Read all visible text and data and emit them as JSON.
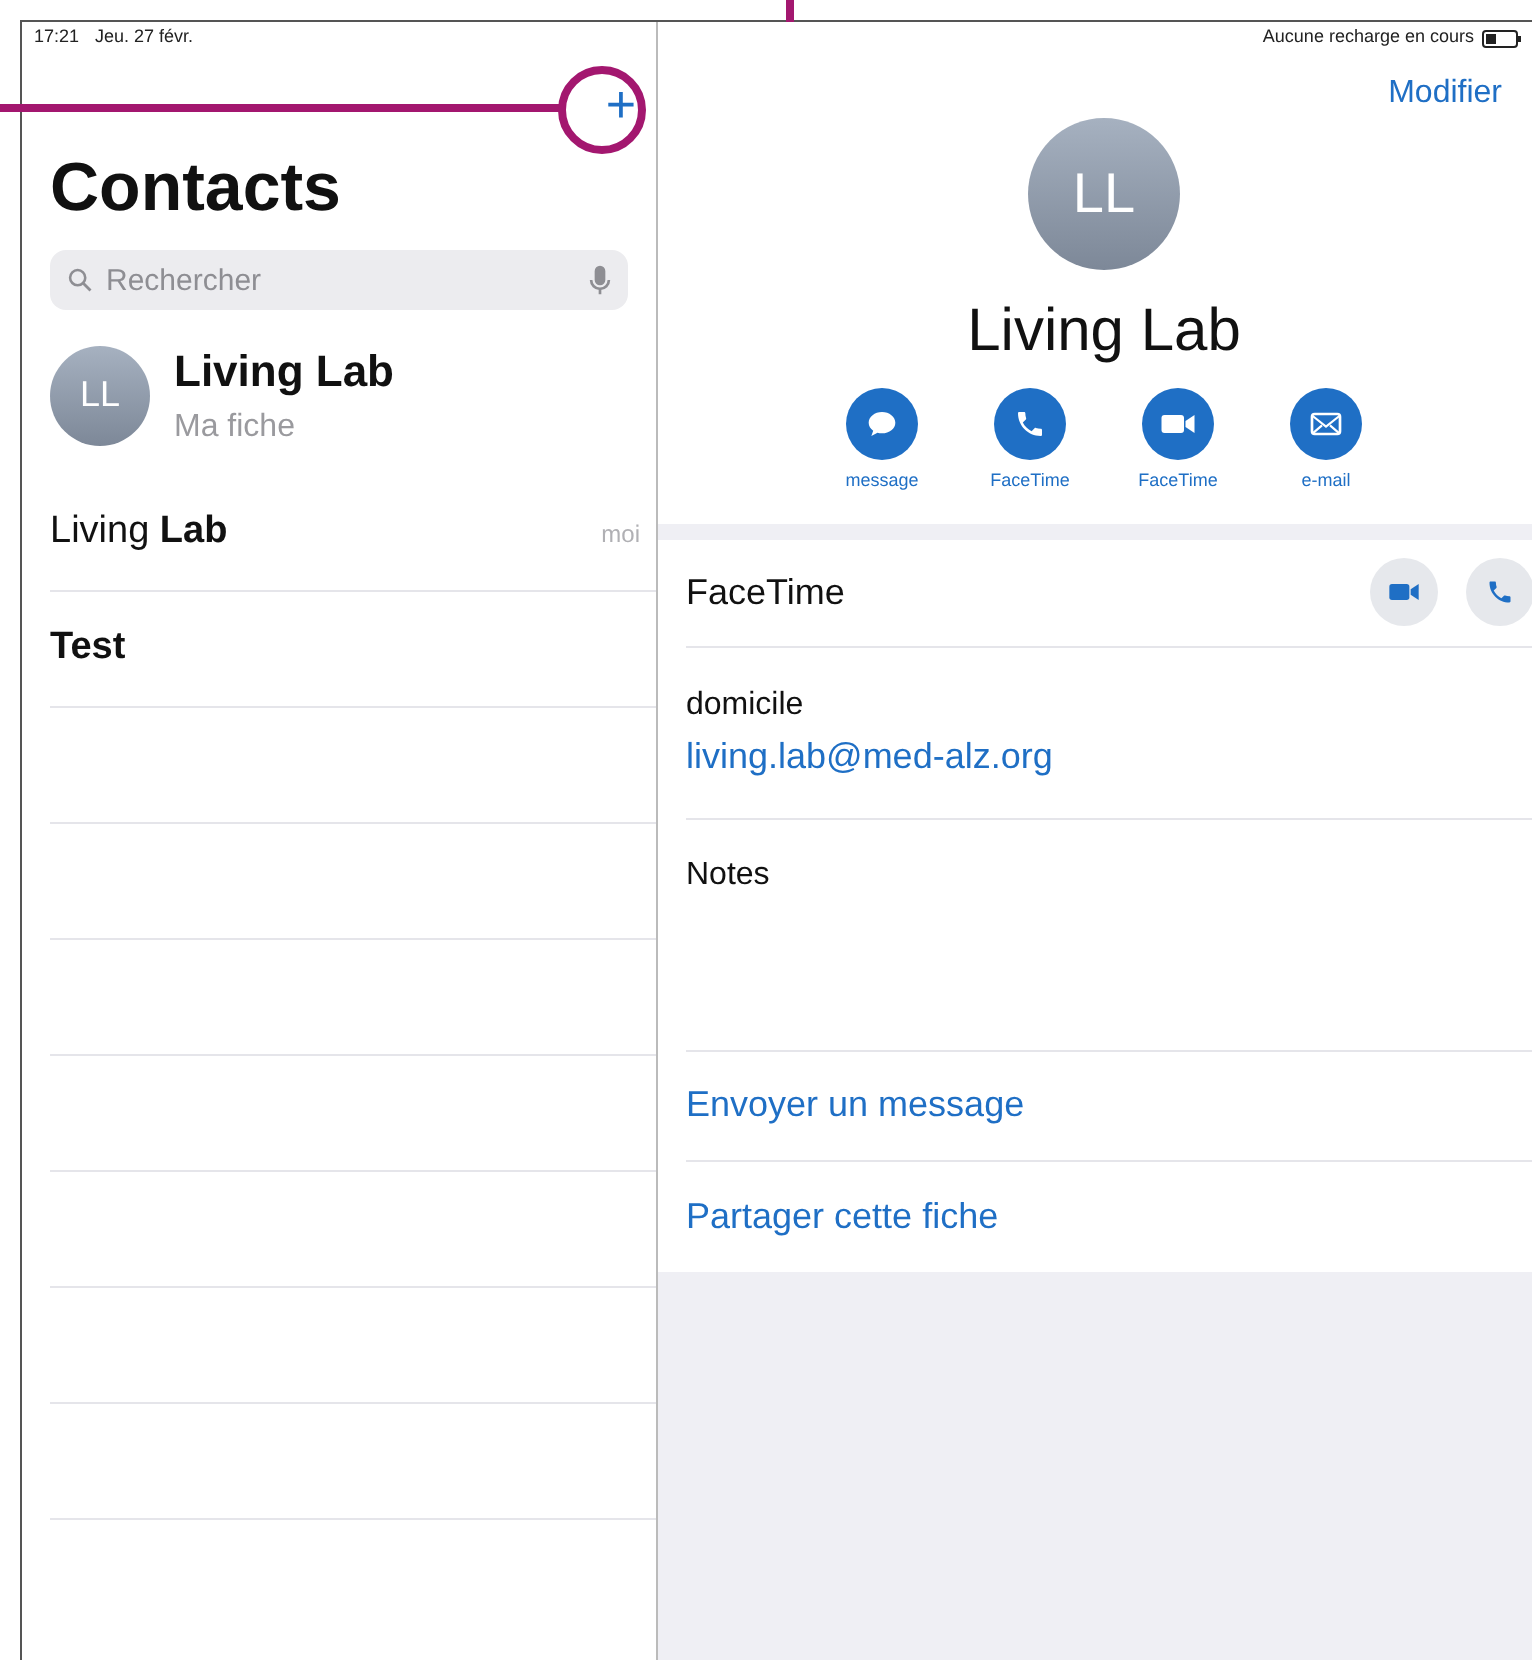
{
  "status_bar": {
    "time": "17:21",
    "date": "Jeu. 27 févr.",
    "charging": "Aucune recharge en cours"
  },
  "sidebar": {
    "add_button": "+",
    "title": "Contacts",
    "search": {
      "placeholder": "Rechercher"
    },
    "my_card": {
      "initials": "LL",
      "name": "Living Lab",
      "subtitle": "Ma fiche"
    },
    "contacts": [
      {
        "name": "Living **Lab**",
        "tag": "moi",
        "bold": false
      },
      {
        "name": "Test",
        "bold": true
      }
    ]
  },
  "detail": {
    "edit": "Modifier",
    "initials": "LL",
    "name": "Living Lab",
    "actions": [
      {
        "kind": "message",
        "label": "message"
      },
      {
        "kind": "phone",
        "label": "FaceTime"
      },
      {
        "kind": "video",
        "label": "FaceTime"
      },
      {
        "kind": "mail",
        "label": "e-mail"
      }
    ],
    "facetime_label": "FaceTime",
    "email_label": "domicile",
    "email": "living.lab@med-alz.org",
    "notes_label": "Notes",
    "links": [
      "Envoyer un message",
      "Partager cette fiche"
    ]
  }
}
